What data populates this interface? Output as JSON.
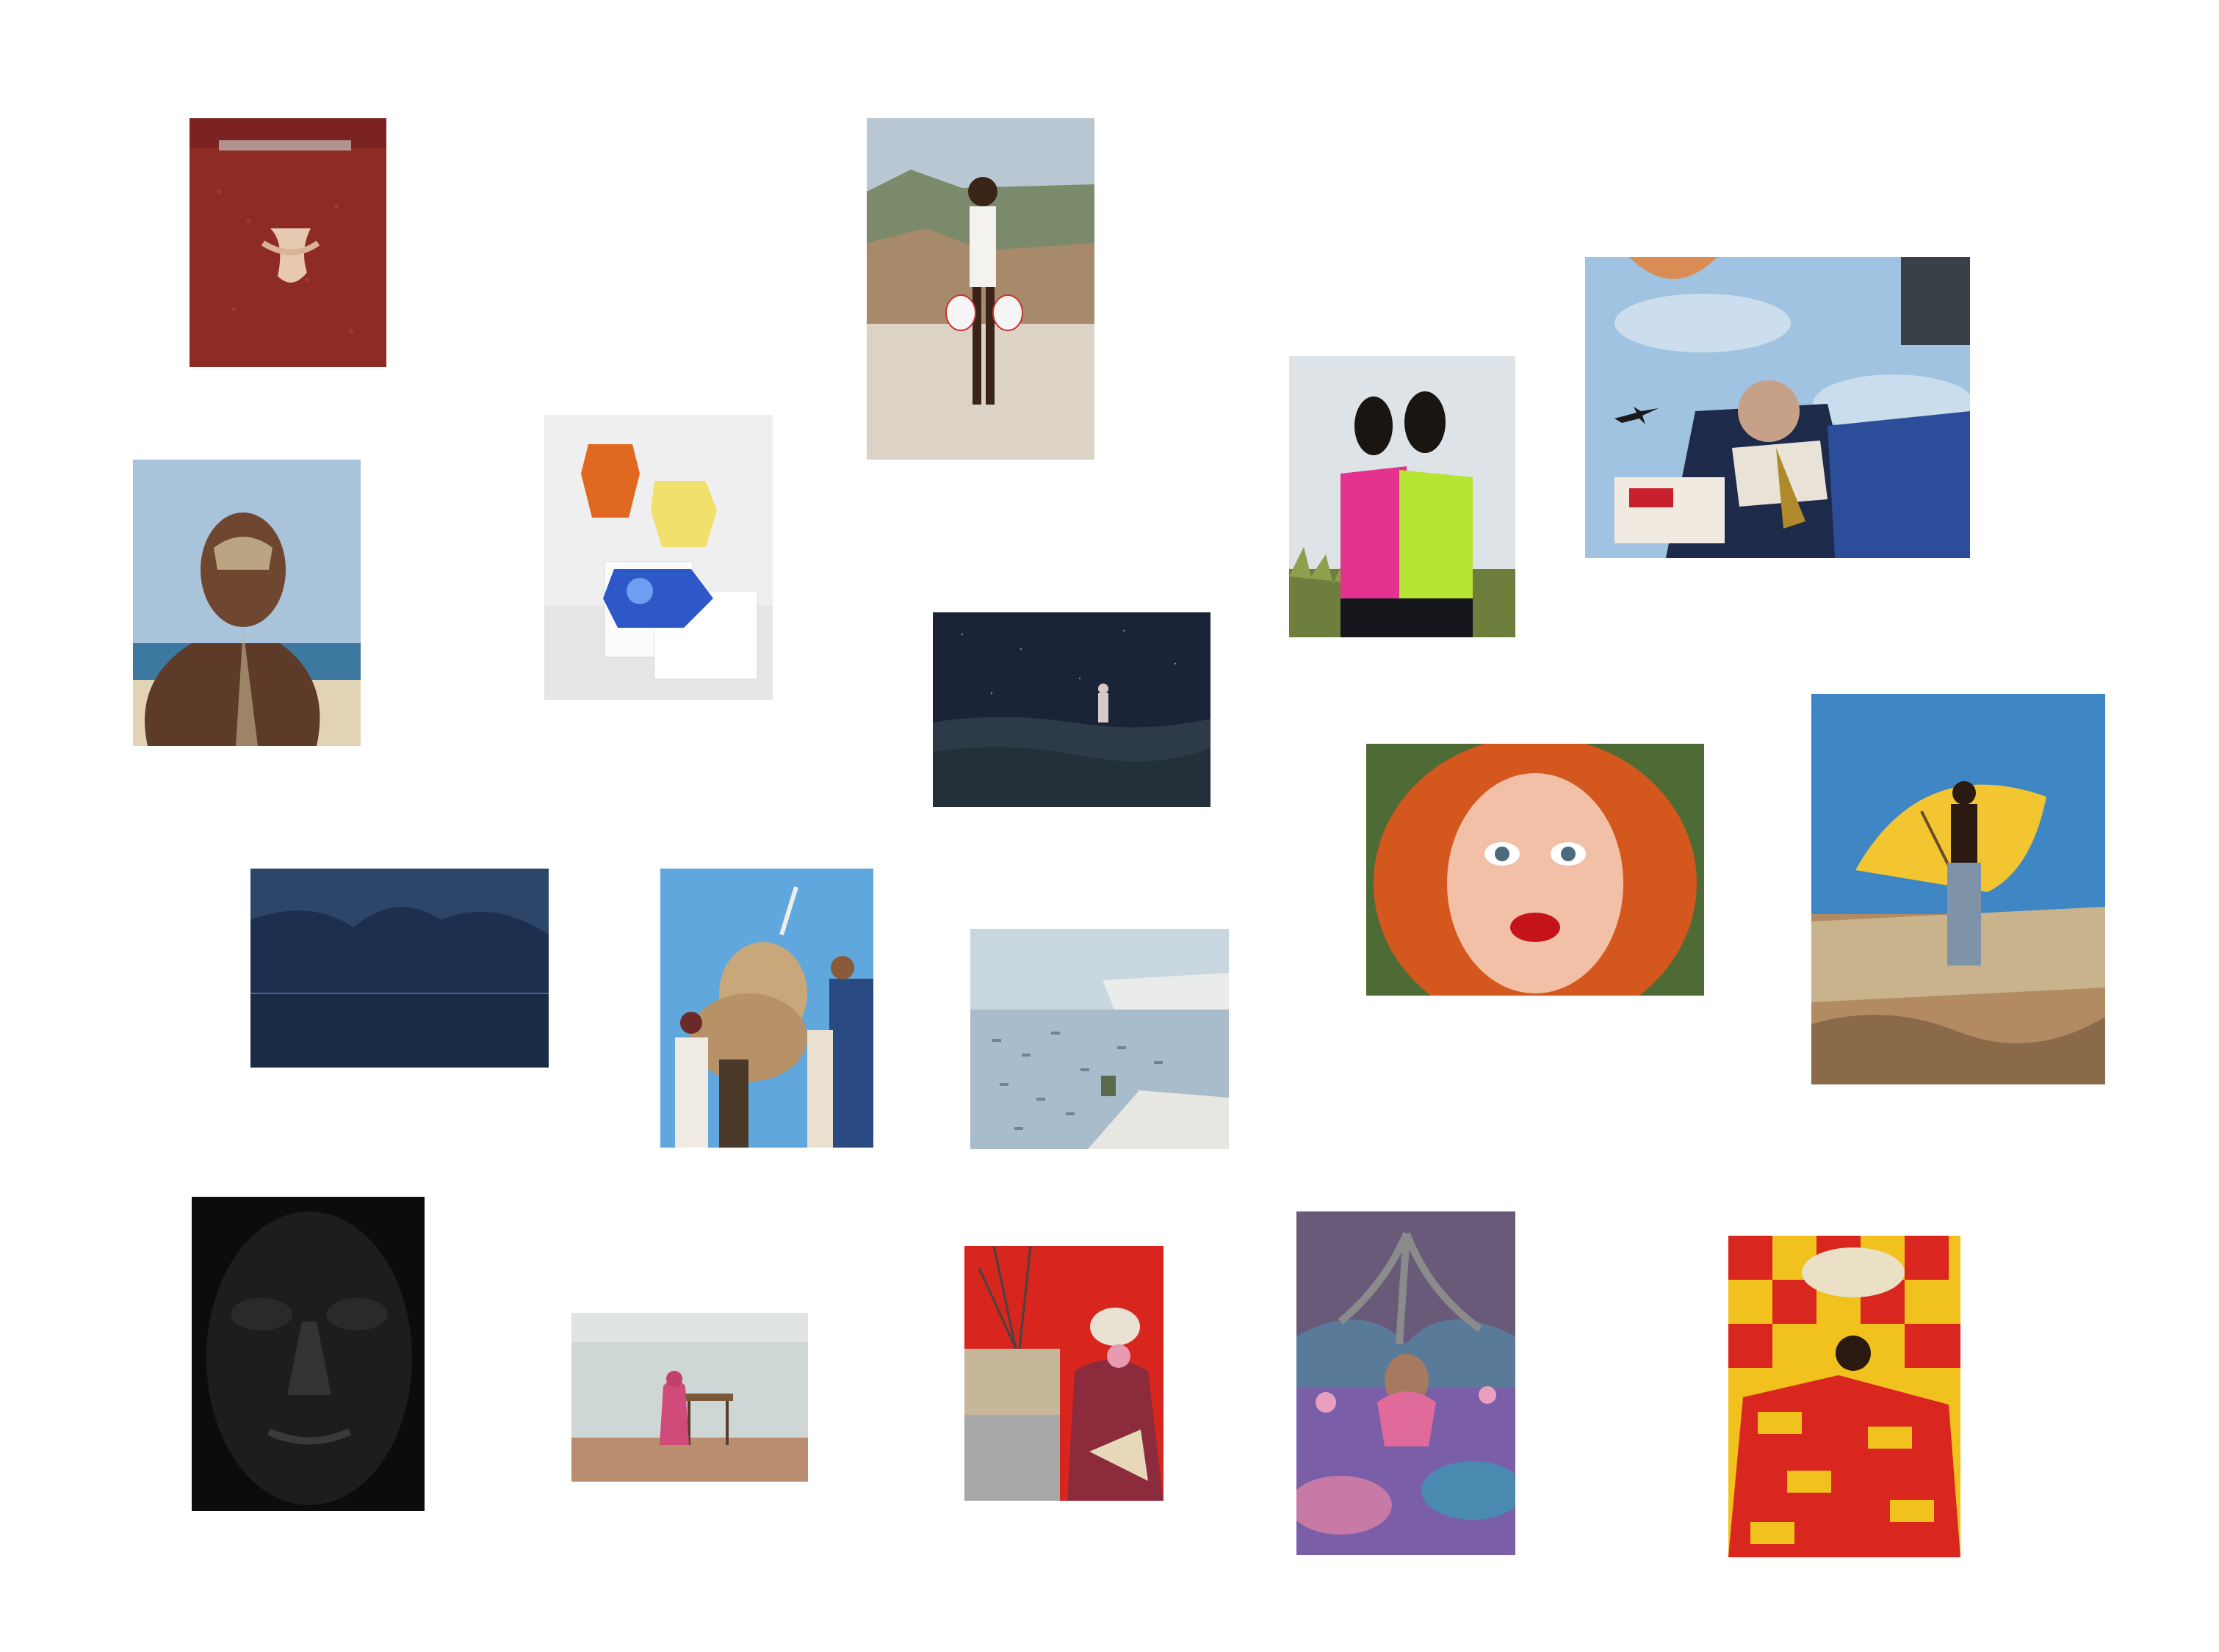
{
  "page": {
    "background": "#ffffff"
  },
  "gallery": {
    "items": [
      {
        "id": "p1",
        "subject": "woman-red-dress-hands-behind-back",
        "palette": [
          "#8e2b25",
          "#b74a3c",
          "#e7c8b0"
        ]
      },
      {
        "id": "p2",
        "subject": "man-boxing-gloves-on-beach",
        "palette": [
          "#d8d1c7",
          "#a7896c",
          "#8ea3b8"
        ]
      },
      {
        "id": "p3",
        "subject": "group-looking-down-with-airplane",
        "palette": [
          "#9fc3e0",
          "#1d2a4a",
          "#e8e3d6"
        ]
      },
      {
        "id": "p4",
        "subject": "two-women-pink-and-lime-tops",
        "palette": [
          "#dde3e6",
          "#e3338f",
          "#b6e433"
        ]
      },
      {
        "id": "p5",
        "subject": "three-printed-shirts-on-plinths",
        "palette": [
          "#eeeeee",
          "#e06820",
          "#2e57c8"
        ]
      },
      {
        "id": "p6",
        "subject": "man-with-sand-on-face-at-sea",
        "palette": [
          "#a9c3da",
          "#3d78a0",
          "#7b5136"
        ]
      },
      {
        "id": "p7",
        "subject": "figure-in-night-landscape",
        "palette": [
          "#1b2436",
          "#2d3a48",
          "#d8c8c8"
        ]
      },
      {
        "id": "p8",
        "subject": "man-with-yellow-umbrella-in-water",
        "palette": [
          "#3e86c4",
          "#f2c531",
          "#b28b63"
        ]
      },
      {
        "id": "p9",
        "subject": "red-haired-woman-close-up",
        "palette": [
          "#d4581e",
          "#f1c0a6",
          "#c4141a"
        ]
      },
      {
        "id": "p10",
        "subject": "stormy-mountain-lake",
        "palette": [
          "#1d2f4f",
          "#2c4569",
          "#0f1a2c"
        ]
      },
      {
        "id": "p11",
        "subject": "people-watching-rocket-launch",
        "palette": [
          "#5fa7dc",
          "#c8a87a",
          "#2a4a82"
        ]
      },
      {
        "id": "p12",
        "subject": "boats-in-misty-bay",
        "palette": [
          "#c8d6e0",
          "#e9ece9",
          "#6f8395"
        ]
      },
      {
        "id": "p13",
        "subject": "dark-sculpted-face",
        "palette": [
          "#0c0c0c",
          "#2a2a2a",
          "#4b4b4b"
        ]
      },
      {
        "id": "p14",
        "subject": "woman-among-roots-and-lotus",
        "palette": [
          "#7a5ea8",
          "#c87aa6",
          "#5a7a9a"
        ]
      },
      {
        "id": "p15",
        "subject": "vendor-in-helmet-red-backdrop",
        "palette": [
          "#d8261f",
          "#8b2b3b",
          "#c7b79a"
        ]
      },
      {
        "id": "p16",
        "subject": "woman-in-jumbo-print-dress",
        "palette": [
          "#f1c21d",
          "#d9261f",
          "#e9e0c5"
        ]
      },
      {
        "id": "p17",
        "subject": "figure-at-desk-in-empty-room",
        "palette": [
          "#cfd6d6",
          "#b88e6e",
          "#d04a7a"
        ]
      }
    ]
  }
}
